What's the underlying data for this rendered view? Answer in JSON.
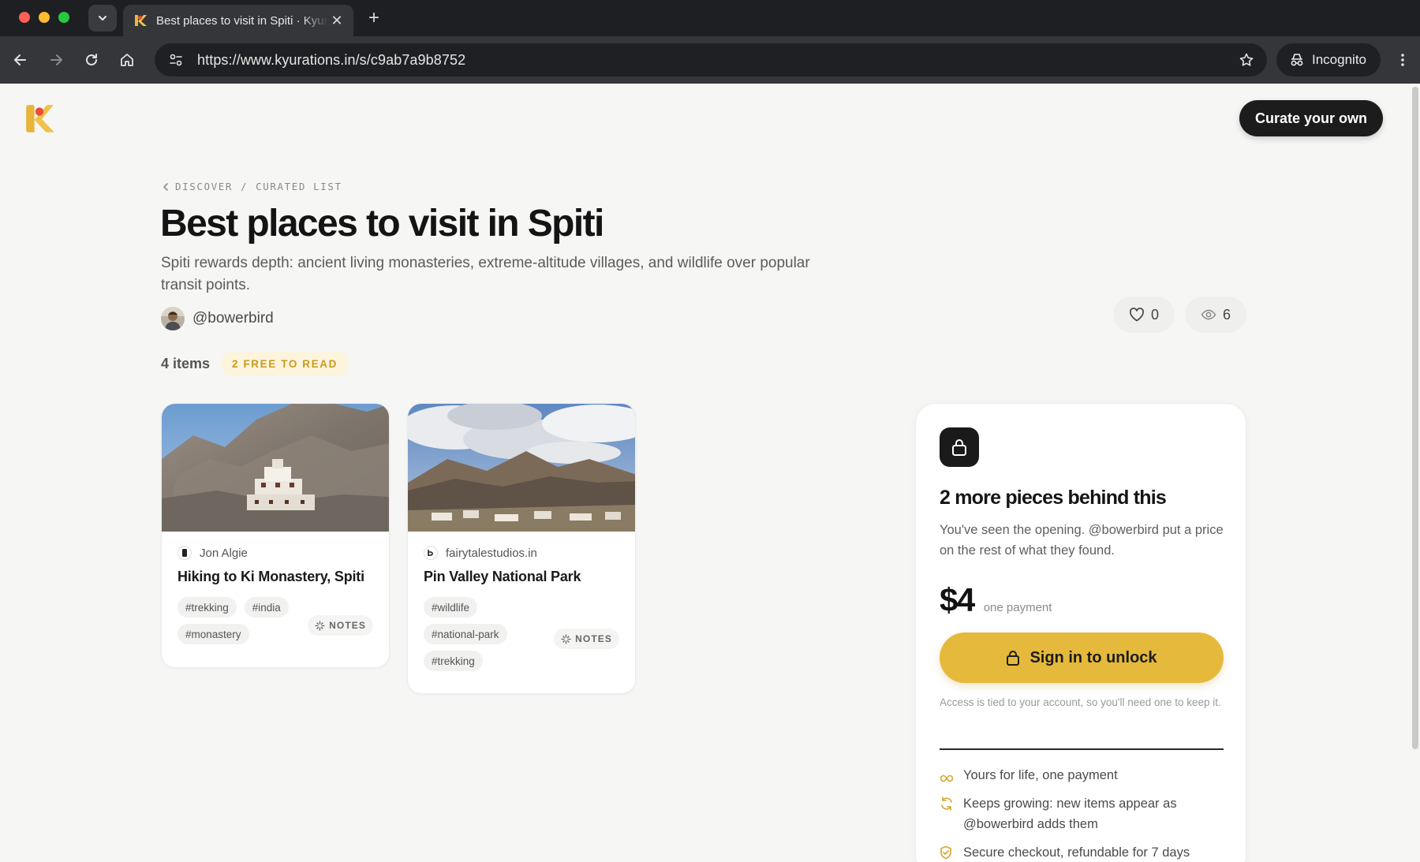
{
  "browser": {
    "tab_title": "Best places to visit in Spiti · Kyurations",
    "url": "https://www.kyurations.in/s/c9ab7a9b8752",
    "incognito_label": "Incognito"
  },
  "header": {
    "curate_label": "Curate your own"
  },
  "breadcrumb": {
    "discover": "DISCOVER",
    "separator": "/",
    "current": "CURATED LIST"
  },
  "list": {
    "title": "Best places to visit in Spiti",
    "description": "Spiti rewards depth: ancient living monasteries, extreme-altitude villages, and wildlife over popular transit points.",
    "author": "@bowerbird",
    "likes": "0",
    "views": "6",
    "items_count": "4 items",
    "free_badge": "2 FREE TO READ"
  },
  "cards": [
    {
      "source": "Jon Algie",
      "title": "Hiking to Ki Monastery, Spiti",
      "tags": [
        "#trekking",
        "#india",
        "#monastery"
      ],
      "notes_label": "NOTES"
    },
    {
      "source": "fairytalestudios.in",
      "title": "Pin Valley National Park",
      "tags": [
        "#wildlife",
        "#national-park",
        "#trekking"
      ],
      "notes_label": "NOTES"
    }
  ],
  "paywall": {
    "title": "2 more pieces behind this",
    "description": "You've seen the opening. @bowerbird put a price on the rest of what they found.",
    "price": "$4",
    "price_note": "one payment",
    "cta": "Sign in to unlock",
    "fine_print": "Access is tied to your account, so you'll need one to keep it.",
    "features": [
      "Yours for life, one payment",
      "Keeps growing: new items appear as @bowerbird adds them",
      "Secure checkout, refundable for 7 days"
    ]
  },
  "colors": {
    "accent": "#e5b93b",
    "badge_text": "#c99a1c",
    "dark": "#1c1c1c"
  }
}
